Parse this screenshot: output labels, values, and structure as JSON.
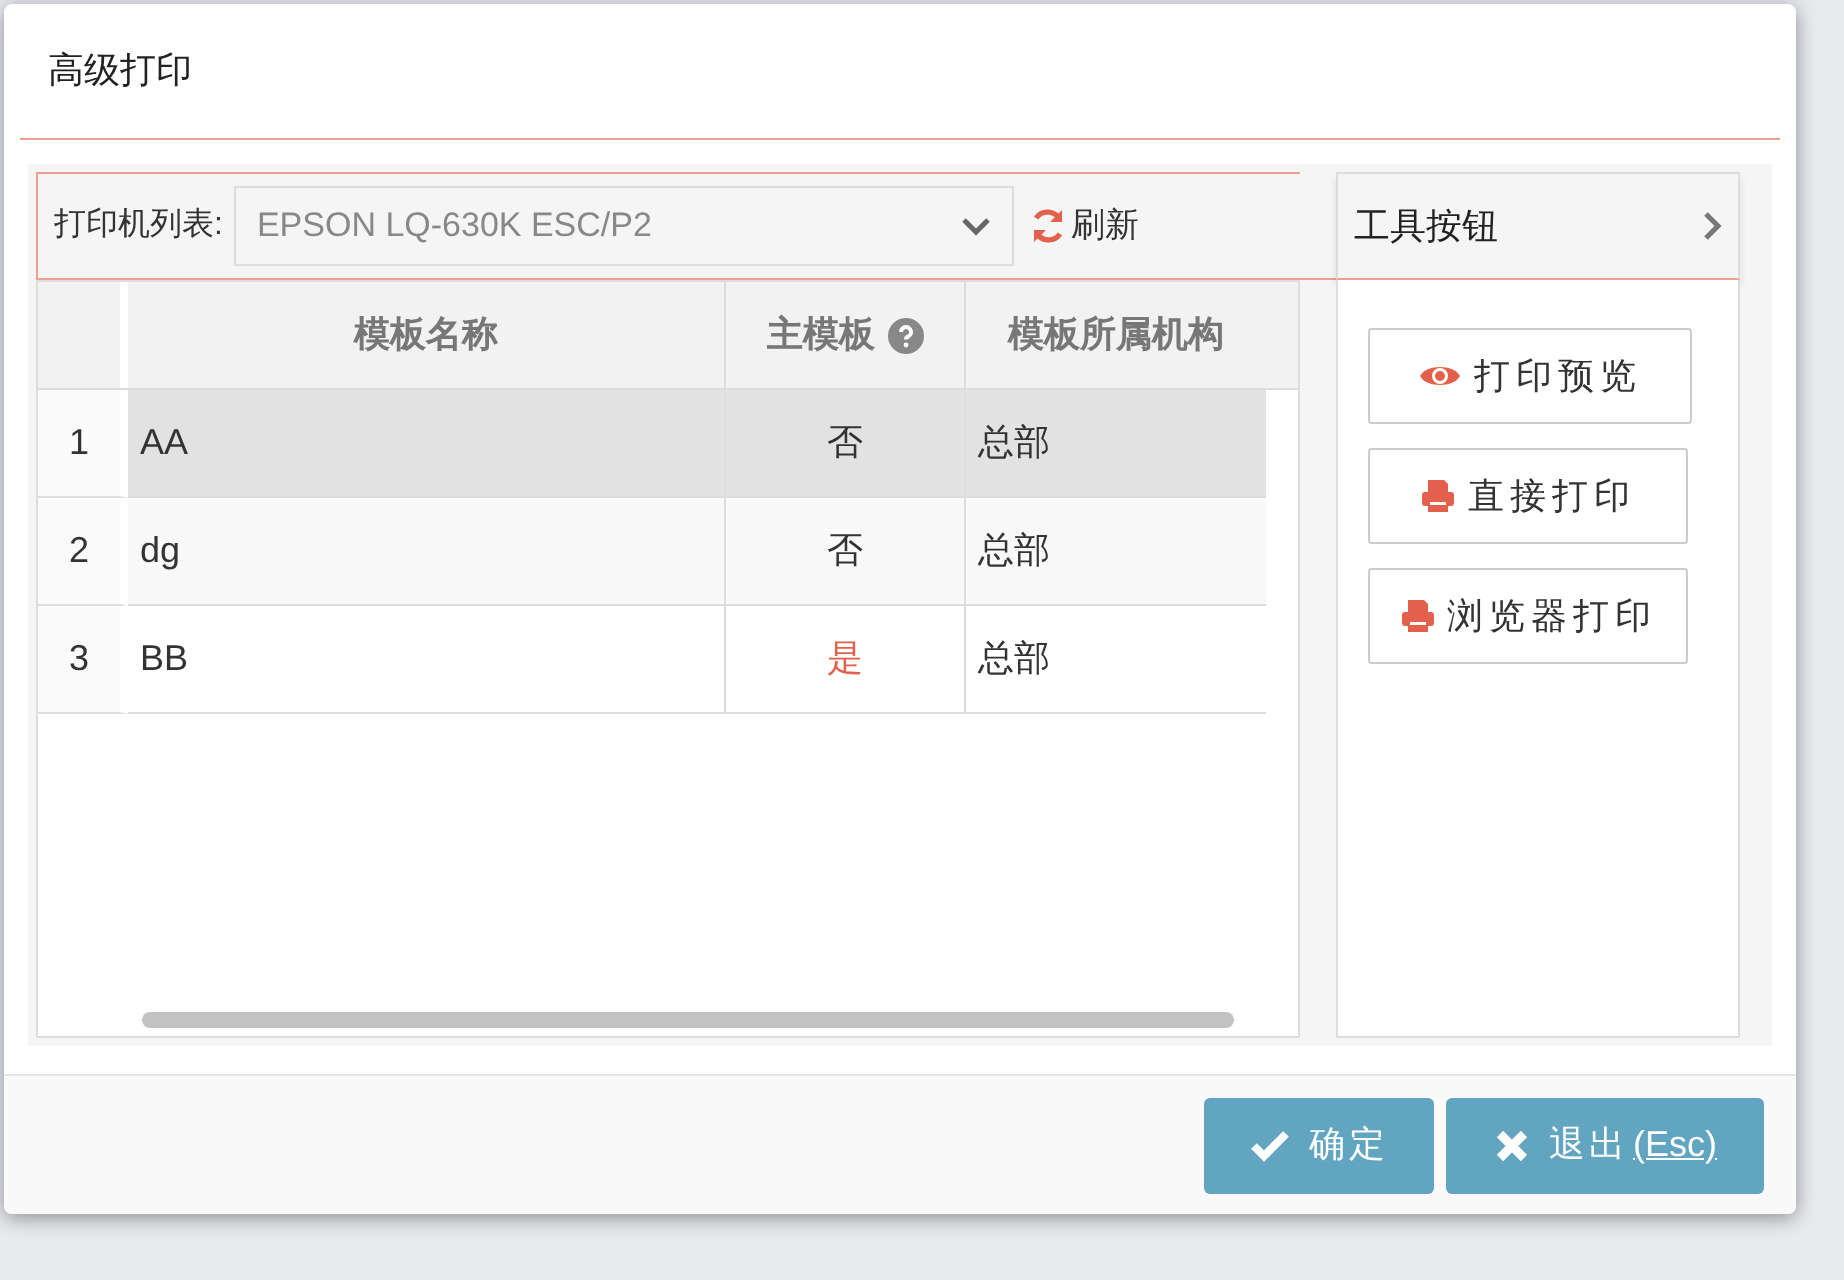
{
  "dialog": {
    "title": "高级打印"
  },
  "printer": {
    "label": "打印机列表:",
    "value": "EPSON LQ-630K ESC/P2",
    "refresh": "刷新"
  },
  "table": {
    "columns": [
      "模板名称",
      "主模板",
      "模板所属机构"
    ],
    "rows": [
      {
        "number": "1",
        "name": "AA",
        "main": "否",
        "is_main": false,
        "org": "总部",
        "selected": true
      },
      {
        "number": "2",
        "name": "dg",
        "main": "否",
        "is_main": false,
        "org": "总部",
        "selected": false
      },
      {
        "number": "3",
        "name": "BB",
        "main": "是",
        "is_main": true,
        "org": "总部",
        "selected": false
      }
    ]
  },
  "tools": {
    "title": "工具按钮",
    "buttons": [
      {
        "label": "打印预览",
        "kind": "preview"
      },
      {
        "label": "直接打印",
        "kind": "print"
      },
      {
        "label": "浏览器打印",
        "kind": "print"
      }
    ]
  },
  "footer": {
    "buttons": [
      {
        "label": "确定",
        "kind": "ok"
      },
      {
        "label": "退出",
        "shortcut": "(Esc)",
        "kind": "exit"
      }
    ]
  }
}
